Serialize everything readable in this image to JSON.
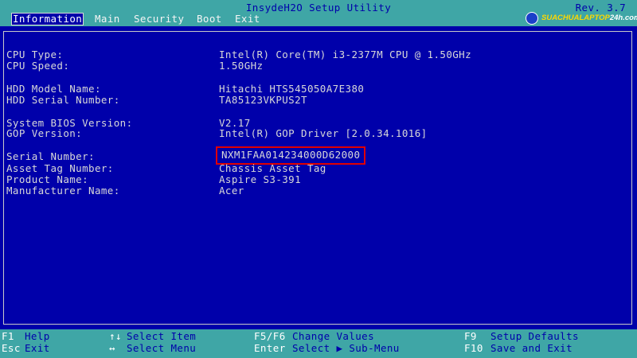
{
  "header": {
    "title": "InsydeH2O Setup Utility",
    "revision": "Rev. 3.7",
    "tabs": [
      {
        "label": "Information",
        "active": true
      },
      {
        "label": "Main"
      },
      {
        "label": "Security"
      },
      {
        "label": "Boot"
      },
      {
        "label": "Exit"
      }
    ],
    "watermark": {
      "prefix": "SUACHUALAPTOP",
      "suffix": "24h.com"
    }
  },
  "info": {
    "cpu_type": {
      "label": "CPU Type:",
      "value": "Intel(R) Core(TM) i3-2377M CPU @ 1.50GHz"
    },
    "cpu_speed": {
      "label": "CPU Speed:",
      "value": "1.50GHz"
    },
    "hdd_model": {
      "label": "HDD Model Name:",
      "value": "Hitachi HTS545050A7E380"
    },
    "hdd_serial": {
      "label": "HDD Serial Number:",
      "value": "TA85123VKPUS2T"
    },
    "bios_version": {
      "label": "System BIOS Version:",
      "value": "V2.17"
    },
    "gop_version": {
      "label": "GOP Version:",
      "value": "Intel(R) GOP Driver [2.0.34.1016]"
    },
    "serial_number": {
      "label": "Serial Number:",
      "value": "NXM1FAA014234000D62000"
    },
    "asset_tag": {
      "label": "Asset Tag Number:",
      "value": "Chassis Asset Tag"
    },
    "product_name": {
      "label": "Product Name:",
      "value": "Aspire S3-391"
    },
    "manufacturer": {
      "label": "Manufacturer Name:",
      "value": "Acer"
    }
  },
  "footer": {
    "f1": {
      "key": "F1",
      "desc": "Help"
    },
    "esc": {
      "key": "Esc",
      "desc": "Exit"
    },
    "updown": {
      "key": "↑↓",
      "desc": "Select Item"
    },
    "lr": {
      "key": "↔",
      "desc": "Select Menu"
    },
    "f5f6": {
      "key": "F5/F6",
      "desc": "Change Values"
    },
    "enter": {
      "key": "Enter",
      "desc": "Select ▶ Sub-Menu"
    },
    "f9": {
      "key": "F9",
      "desc": "Setup Defaults"
    },
    "f10": {
      "key": "F10",
      "desc": "Save and Exit"
    }
  },
  "colors": {
    "background": "#0000aa",
    "bar": "#3fa6a6",
    "highlight_border": "#e00000",
    "text": "#d8d8d8"
  }
}
